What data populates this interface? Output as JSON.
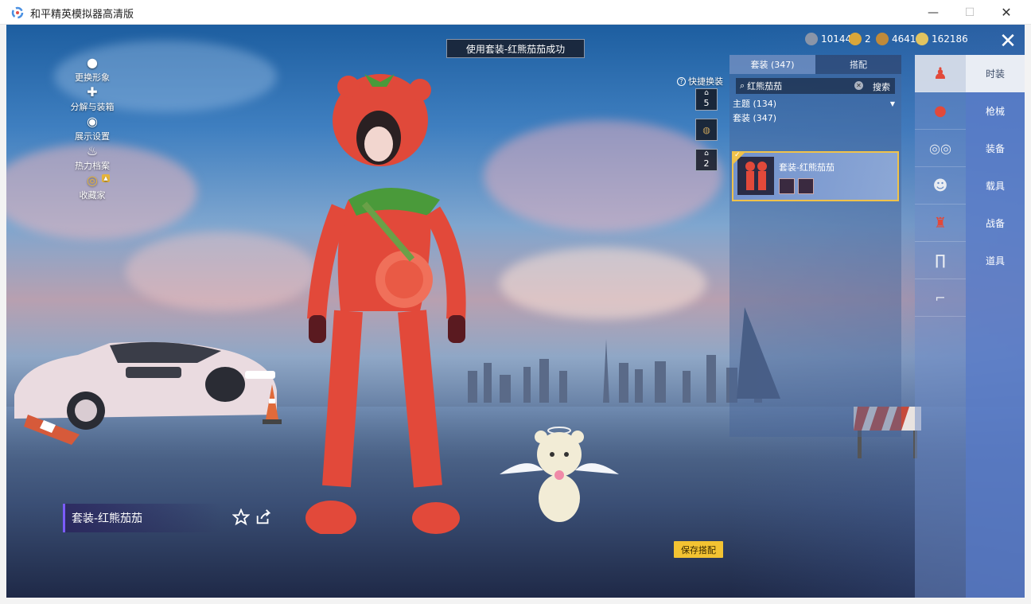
{
  "window": {
    "title": "和平精英模拟器高清版",
    "minimize": "—",
    "maximize": "☐",
    "close": "✕"
  },
  "toast": "使用套装-红熊茄茄成功",
  "currency": [
    {
      "value": "10144",
      "color": "#8a95a8"
    },
    {
      "value": "2",
      "color": "#d9a63a"
    },
    {
      "value": "4641",
      "color": "#c08a3a"
    },
    {
      "value": "162186",
      "color": "#e2c460"
    }
  ],
  "left_menu": [
    {
      "label": "更换形象",
      "icon": "person-icon"
    },
    {
      "label": "分解与装箱",
      "icon": "puzzle-icon"
    },
    {
      "label": "展示设置",
      "icon": "eye-icon"
    },
    {
      "label": "热力档案",
      "icon": "fire-icon"
    },
    {
      "label": "收藏家",
      "icon": "medal-icon"
    }
  ],
  "outfit_name": "套装-红熊茄茄",
  "save_button": "保存搭配",
  "quick_change": {
    "label": "快捷换装",
    "slots": [
      "5",
      "",
      "2"
    ]
  },
  "panel": {
    "tabs": [
      "套装 (347)",
      "搭配"
    ],
    "search_value": "红熊茄茄",
    "search_button": "搜索",
    "filter": "主题 (134)",
    "section": "套装 (347)",
    "item_name": "套装-红熊茄茄"
  },
  "categories": [
    "时装",
    "枪械",
    "装备",
    "载具",
    "战备",
    "道具"
  ],
  "colors": {
    "accent_gold": "#f3c332",
    "panel_blue": "#5a7dc8",
    "name_bar": "#7b5cff"
  }
}
